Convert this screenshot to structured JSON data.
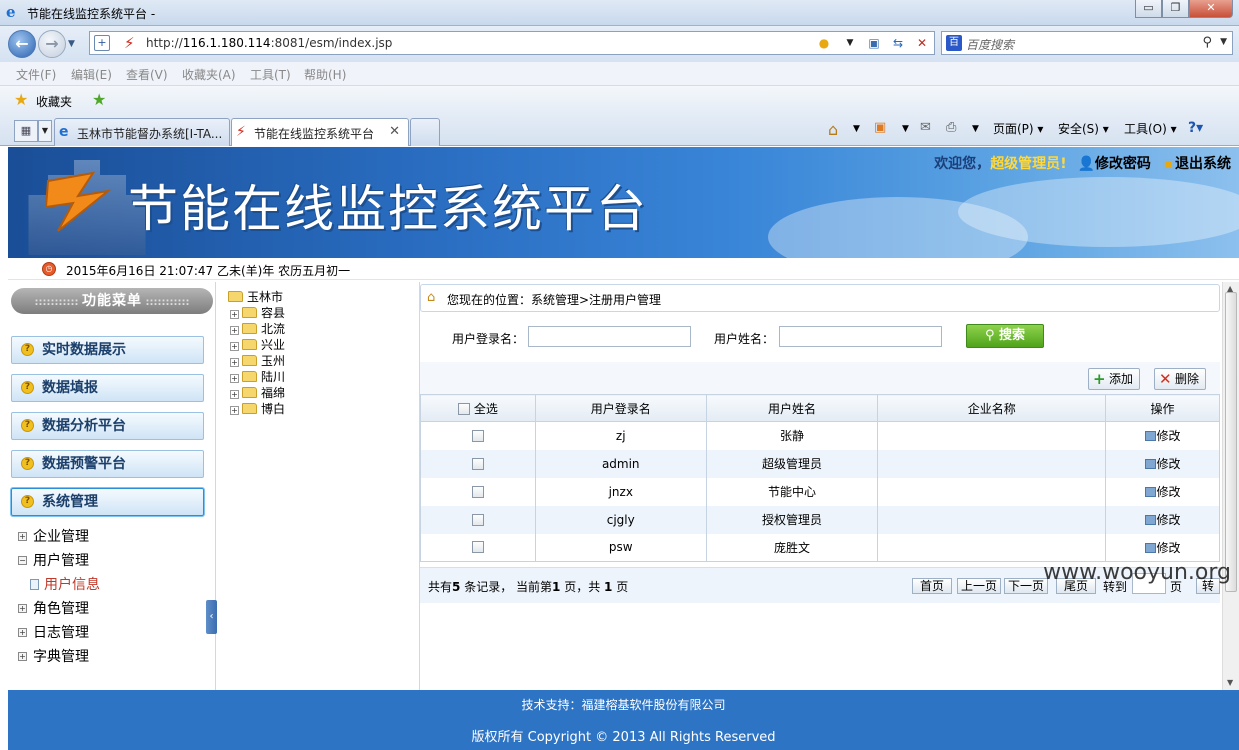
{
  "window": {
    "title": "节能在线监控系统平台 -",
    "minimize": "▭",
    "restore": "❐",
    "close": "✕"
  },
  "address": {
    "url_prefix": "http://",
    "url_host": "116.1.180.114",
    "url_rest": ":8081/esm/index.jsp",
    "search_placeholder": "百度搜索"
  },
  "menu": [
    "文件(F)",
    "编辑(E)",
    "查看(V)",
    "收藏夹(A)",
    "工具(T)",
    "帮助(H)"
  ],
  "favorites": {
    "label": "收藏夹"
  },
  "tabs": [
    {
      "label": "玉林市节能督办系统[I-TA..."
    },
    {
      "label": "节能在线监控系统平台"
    }
  ],
  "commands": [
    "页面(P) ▾",
    "安全(S) ▾",
    "工具(O) ▾"
  ],
  "banner": {
    "title": "节能在线监控系统平台",
    "welcome_prefix": "欢迎您，",
    "role": "超级管理员",
    "welcome_suffix": "!",
    "change_password": "修改密码",
    "logout": "退出系统"
  },
  "datebar": {
    "text": "2015年6月16日  21:07:47 乙未(羊)年  农历五月初一"
  },
  "sidebar": {
    "heading": "功能菜单",
    "items": [
      "实时数据展示",
      "数据填报",
      "数据分析平台",
      "数据预警平台",
      "系统管理"
    ],
    "sub": [
      {
        "label": "企业管理",
        "sign": "+"
      },
      {
        "label": "用户管理",
        "sign": "−"
      },
      {
        "label": "用户信息",
        "leaf": true
      },
      {
        "label": "角色管理",
        "sign": "+"
      },
      {
        "label": "日志管理",
        "sign": "+"
      },
      {
        "label": "字典管理",
        "sign": "+"
      }
    ]
  },
  "tree": {
    "root": "玉林市",
    "children": [
      "容县",
      "北流",
      "兴业",
      "玉州",
      "陆川",
      "福绵",
      "博白"
    ]
  },
  "main": {
    "breadcrumb": "您现在的位置：系统管理>注册用户管理",
    "login_label": "用户登录名：",
    "name_label": "用户姓名：",
    "search_button": "搜索",
    "add_button": "添加",
    "delete_button": "删除",
    "columns": [
      "全选",
      "用户登录名",
      "用户姓名",
      "企业名称",
      "操作"
    ],
    "rows": [
      {
        "login": "zj",
        "name": "张静",
        "company": "",
        "action": "修改"
      },
      {
        "login": "admin",
        "name": "超级管理员",
        "company": "",
        "action": "修改"
      },
      {
        "login": "jnzx",
        "name": "节能中心",
        "company": "",
        "action": "修改"
      },
      {
        "login": "cjgly",
        "name": "授权管理员",
        "company": "",
        "action": "修改"
      },
      {
        "login": "psw",
        "name": "庞胜文",
        "company": "",
        "action": "修改"
      }
    ],
    "pager": {
      "t1": "共有",
      "total": "5",
      "t2": " 条记录， 当前第",
      "current": "1",
      "t3": " 页，共 ",
      "pages": "1",
      "t4": " 页",
      "first": "首页",
      "prev": "上一页",
      "next": "下一页",
      "last": "尾页",
      "goto": "转到",
      "page_unit": "页",
      "go": "转"
    }
  },
  "footer": {
    "support": "技术支持：福建榕基软件股份有限公司",
    "copyright": "版权所有 Copyright © 2013 All Rights Reserved",
    "watermark": "www.wooyun.org"
  }
}
